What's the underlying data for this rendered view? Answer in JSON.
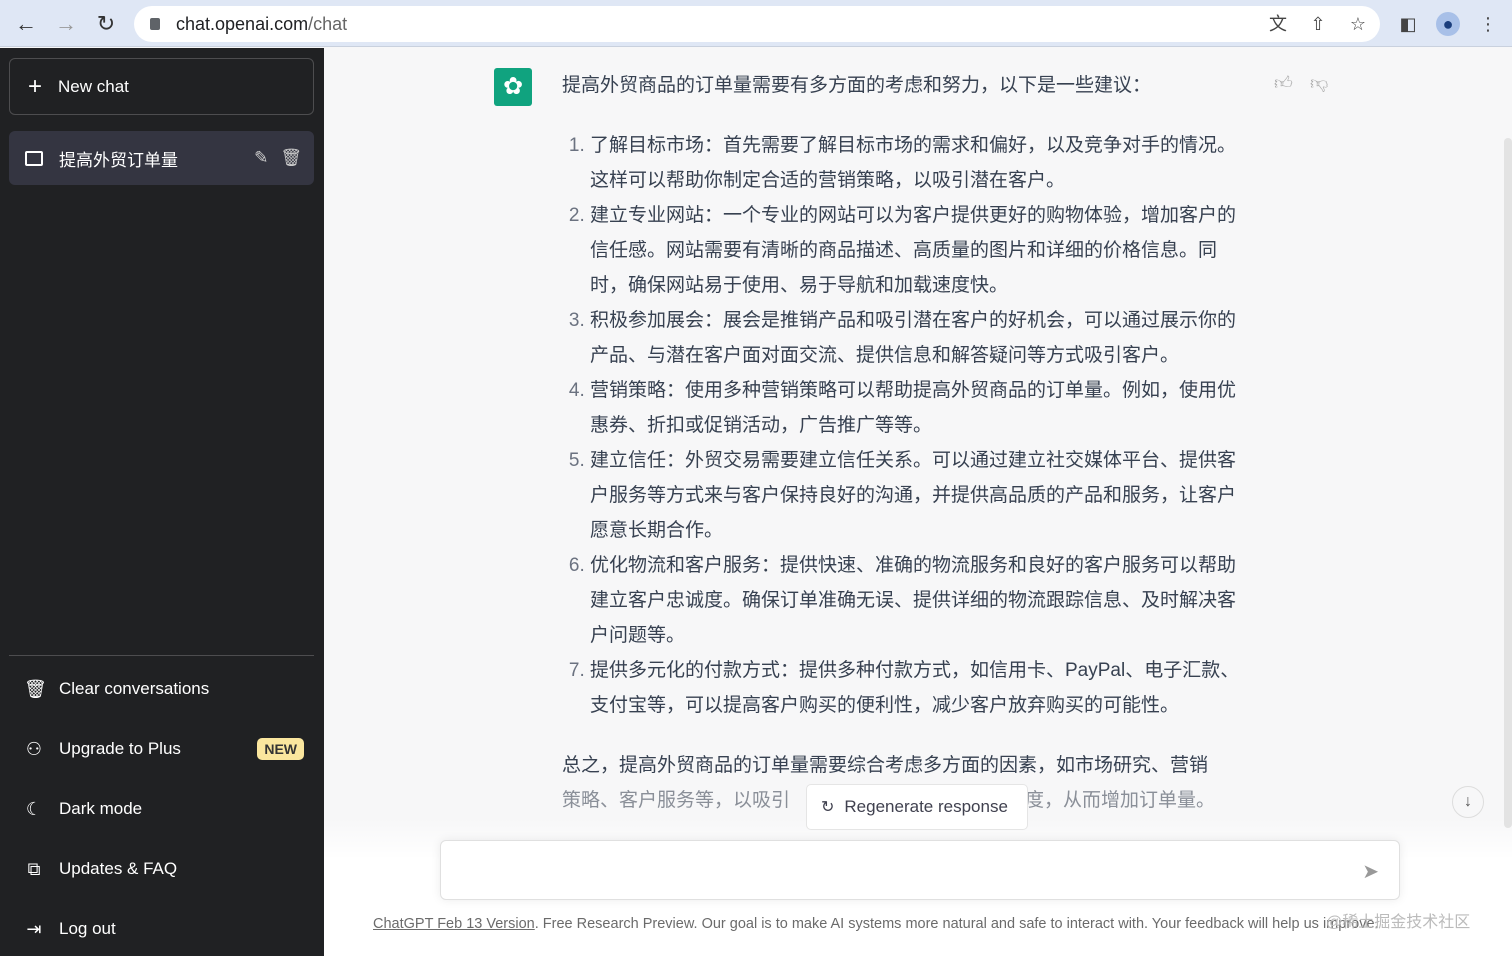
{
  "browser": {
    "url_host": "chat.openai.com",
    "url_path": "/chat",
    "icons": [
      "back-icon",
      "forward-icon",
      "reload-icon",
      "lock-icon",
      "translate-icon",
      "share-icon",
      "star-icon",
      "sidepanel-icon",
      "profile-icon",
      "menu-icon"
    ]
  },
  "sidebar": {
    "new_chat": "New chat",
    "conversations": [
      {
        "title": "提高外贸订单量"
      }
    ],
    "items": [
      {
        "label": "Clear conversations",
        "icon": "trash-icon"
      },
      {
        "label": "Upgrade to Plus",
        "icon": "user-icon",
        "badge": "NEW"
      },
      {
        "label": "Dark mode",
        "icon": "moon-icon"
      },
      {
        "label": "Updates & FAQ",
        "icon": "external-link-icon"
      },
      {
        "label": "Log out",
        "icon": "logout-icon"
      }
    ]
  },
  "message": {
    "intro": "提高外贸商品的订单量需要有多方面的考虑和努力，以下是一些建议：",
    "list": [
      "了解目标市场：首先需要了解目标市场的需求和偏好，以及竞争对手的情况。这样可以帮助你制定合适的营销策略，以吸引潜在客户。",
      "建立专业网站：一个专业的网站可以为客户提供更好的购物体验，增加客户的信任感。网站需要有清晰的商品描述、高质量的图片和详细的价格信息。同时，确保网站易于使用、易于导航和加载速度快。",
      "积极参加展会：展会是推销产品和吸引潜在客户的好机会，可以通过展示你的产品、与潜在客户面对面交流、提供信息和解答疑问等方式吸引客户。",
      "营销策略：使用多种营销策略可以帮助提高外贸商品的订单量。例如，使用优惠券、折扣或促销活动，广告推广等等。",
      "建立信任：外贸交易需要建立信任关系。可以通过建立社交媒体平台、提供客户服务等方式来与客户保持良好的沟通，并提供高品质的产品和服务，让客户愿意长期合作。",
      "优化物流和客户服务：提供快速、准确的物流服务和良好的客户服务可以帮助建立客户忠诚度。确保订单准确无误、提供详细的物流跟踪信息、及时解决客户问题等。",
      "提供多元化的付款方式：提供多种付款方式，如信用卡、PayPal、电子汇款、支付宝等，可以提高客户购买的便利性，减少客户放弃购买的可能性。"
    ],
    "summary_line1": "总之，提高外贸商品的订单量需要综合考虑多方面的因素，如市场研究、营销",
    "summary_visible_start": "策略、客户服务等，以吸引",
    "summary_visible_end": "度，从而增加订单量。"
  },
  "regenerate": "Regenerate response",
  "input": {
    "value": "",
    "placeholder": ""
  },
  "footer": {
    "link": "ChatGPT Feb 13 Version",
    "text": ". Free Research Preview. Our goal is to make AI systems more natural and safe to interact with. Your feedback will help us improve."
  },
  "watermark": "@稀土掘金技术社区",
  "colors": {
    "sidebar": "#202123",
    "accent": "#10a37f",
    "badge": "#fae69e"
  }
}
